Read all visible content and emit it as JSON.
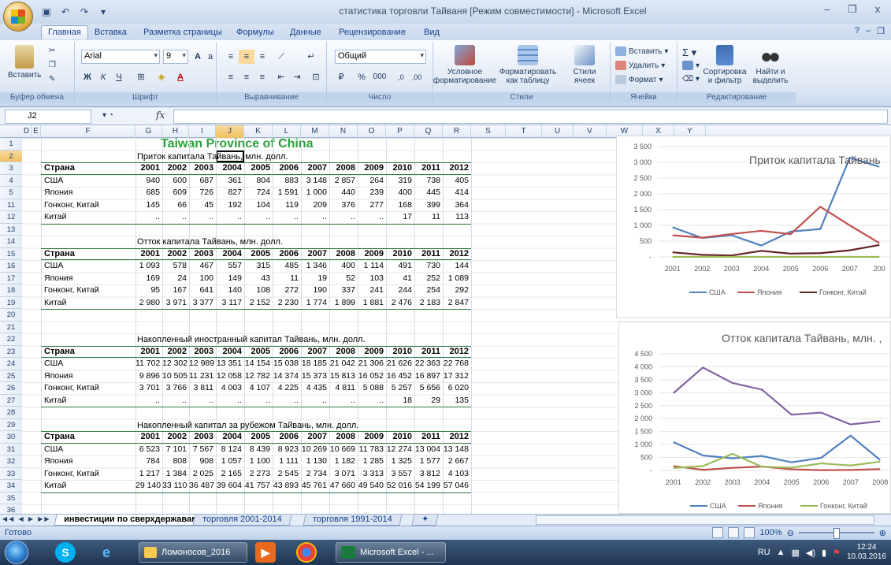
{
  "window": {
    "title": "статистика торговли Тайваня  [Режим совместимости] - Microsoft Excel",
    "minimize": "–",
    "restore": "❐",
    "close": "x"
  },
  "ribbon": {
    "tabs": [
      "Главная",
      "Вставка",
      "Разметка страницы",
      "Формулы",
      "Данные",
      "Рецензирование",
      "Вид"
    ],
    "active_tab": "Главная",
    "paste_label": "Вставить",
    "font_name": "Arial",
    "font_size": "9",
    "number_format": "Общий",
    "conditional_format": "Условное форматирование",
    "format_as_table": "Форматировать как таблицу",
    "cell_styles": "Стили ячеек",
    "insert_cells": "Вставить",
    "delete_cells": "Удалить",
    "format_cells": "Формат",
    "sort_filter": "Сортировка и фильтр",
    "find_select": "Найти и выделить",
    "groups": [
      "Буфер обмена",
      "Шрифт",
      "Выравнивание",
      "Число",
      "Стили",
      "Ячейки",
      "Редактирование"
    ]
  },
  "formula_bar": {
    "name_box": "J2",
    "fx": "fx",
    "formula": ""
  },
  "columns": [
    "D",
    "E",
    "F",
    "G",
    "H",
    "I",
    "J",
    "K",
    "L",
    "M",
    "N",
    "O",
    "P",
    "Q",
    "R",
    "S",
    "T",
    "U",
    "V",
    "W",
    "X",
    "Y"
  ],
  "rows": [
    "1",
    "2",
    "3",
    "4",
    "5",
    "11",
    "12",
    "13",
    "14",
    "15",
    "16",
    "17",
    "18",
    "19",
    "20",
    "21",
    "22",
    "23",
    "24",
    "25",
    "26",
    "27",
    "28",
    "29",
    "30",
    "31",
    "32",
    "33",
    "34",
    "35",
    "36"
  ],
  "sheet": {
    "main_title": "Taiwan Province of China",
    "country_header": "Страна",
    "years": [
      "2001",
      "2002",
      "2003",
      "2004",
      "2005",
      "2006",
      "2007",
      "2008",
      "2009",
      "2010",
      "2011",
      "2012"
    ],
    "tables": [
      {
        "title": "Приток капитала Тайвань, млн. долл.",
        "rows": [
          {
            "country": "США",
            "values": [
              "940",
              "600",
              "687",
              "361",
              "804",
              "883",
              "3 148",
              "2 857",
              "264",
              "319",
              "738",
              "405"
            ]
          },
          {
            "country": "Япония",
            "values": [
              "685",
              "609",
              "726",
              "827",
              "724",
              "1 591",
              "1 000",
              "440",
              "239",
              "400",
              "445",
              "414"
            ]
          },
          {
            "country": "Гонконг, Китай",
            "values": [
              "145",
              "66",
              "45",
              "192",
              "104",
              "119",
              "209",
              "376",
              "277",
              "168",
              "399",
              "364"
            ]
          },
          {
            "country": "Китай",
            "values": [
              "..",
              "..",
              "..",
              "..",
              "..",
              "..",
              "..",
              "..",
              "..",
              "17",
              "11",
              "113"
            ]
          }
        ]
      },
      {
        "title": "Отток капитала Тайвань, млн. долл.",
        "rows": [
          {
            "country": "США",
            "values": [
              "1 093",
              "578",
              "467",
              "557",
              "315",
              "485",
              "1 346",
              "400",
              "1 114",
              "491",
              "730",
              "144"
            ]
          },
          {
            "country": "Япония",
            "values": [
              "169",
              "24",
              "100",
              "149",
              "43",
              "11",
              "19",
              "52",
              "103",
              "41",
              "252",
              "1 089"
            ]
          },
          {
            "country": "Гонконг, Китай",
            "values": [
              "95",
              "167",
              "641",
              "140",
              "108",
              "272",
              "190",
              "337",
              "241",
              "244",
              "254",
              "292"
            ]
          },
          {
            "country": "Китай",
            "values": [
              "2 980",
              "3 971",
              "3 377",
              "3 117",
              "2 152",
              "2 230",
              "1 774",
              "1 899",
              "1 881",
              "2 476",
              "2 183",
              "2 847"
            ]
          }
        ]
      },
      {
        "title": "Накопленный иностранный капитал Тайвань, млн. долл.",
        "rows": [
          {
            "country": "США",
            "values": [
              "11 702",
              "12 302",
              "12 989",
              "13 351",
              "14 154",
              "15 038",
              "18 185",
              "21 042",
              "21 306",
              "21 626",
              "22 363",
              "22 768"
            ]
          },
          {
            "country": "Япония",
            "values": [
              "9 896",
              "10 505",
              "11 231",
              "12 058",
              "12 782",
              "14 374",
              "15 373",
              "15 813",
              "16 052",
              "16 452",
              "16 897",
              "17 312"
            ]
          },
          {
            "country": "Гонконг, Китай",
            "values": [
              "3 701",
              "3 766",
              "3 811",
              "4 003",
              "4 107",
              "4 225",
              "4 435",
              "4 811",
              "5 088",
              "5 257",
              "5 656",
              "6 020"
            ]
          },
          {
            "country": "Китай",
            "values": [
              "..",
              "..",
              "..",
              "..",
              "..",
              "..",
              "..",
              "..",
              "..",
              "18",
              "29",
              "135"
            ]
          }
        ]
      },
      {
        "title": "Накопленный  капитал за рубежом Тайвань, млн. долл.",
        "rows": [
          {
            "country": "США",
            "values": [
              "6 523",
              "7 101",
              "7 567",
              "8 124",
              "8 439",
              "8 923",
              "10 269",
              "10 669",
              "11 783",
              "12 274",
              "13 004",
              "13 148"
            ]
          },
          {
            "country": "Япония",
            "values": [
              "784",
              "808",
              "908",
              "1 057",
              "1 100",
              "1 111",
              "1 130",
              "1 182",
              "1 285",
              "1 325",
              "1 577",
              "2 667"
            ]
          },
          {
            "country": "Гонконг, Китай",
            "values": [
              "1 217",
              "1 384",
              "2 025",
              "2 165",
              "2 273",
              "2 545",
              "2 734",
              "3 071",
              "3 313",
              "3 557",
              "3 812",
              "4 103"
            ]
          },
          {
            "country": "Китай",
            "values": [
              "29 140",
              "33 110",
              "36 487",
              "39 604",
              "41 757",
              "43 893",
              "45 761",
              "47 660",
              "49 540",
              "52 016",
              "54 199",
              "57 046"
            ]
          }
        ]
      }
    ]
  },
  "chart_data": [
    {
      "type": "line",
      "title": "Приток капитала Тайвань",
      "x": [
        "2001",
        "2002",
        "2003",
        "2004",
        "2005",
        "2006",
        "2007",
        "200"
      ],
      "ylim": [
        0,
        3500
      ],
      "yticks": [
        "3 500",
        "3 000",
        "2 500",
        "2 000",
        "1 500",
        "1 000",
        "500",
        "-"
      ],
      "series": [
        {
          "name": "США",
          "color": "#4f81bd",
          "values": [
            940,
            600,
            687,
            361,
            804,
            883,
            3148,
            2857
          ]
        },
        {
          "name": "Япония",
          "color": "#c0504d",
          "values": [
            685,
            609,
            726,
            827,
            724,
            1591,
            1000,
            440
          ]
        },
        {
          "name": "Гонконг, Китай",
          "color": "#632523",
          "values": [
            145,
            66,
            45,
            192,
            104,
            119,
            209,
            376
          ]
        },
        {
          "name": "",
          "color": "#9bbb59",
          "values": [
            0,
            0,
            0,
            0,
            0,
            0,
            0,
            0
          ]
        }
      ],
      "legend": "bottom"
    },
    {
      "type": "line",
      "title": "Отток капитала Тайвань, млн. ,",
      "x": [
        "2001",
        "2002",
        "2003",
        "2004",
        "2005",
        "2006",
        "2007",
        "2008"
      ],
      "ylim": [
        0,
        4500
      ],
      "yticks": [
        "4 500",
        "4 000",
        "3 500",
        "3 000",
        "2 500",
        "2 000",
        "1 500",
        "1 000",
        "500",
        "-"
      ],
      "series": [
        {
          "name": "США",
          "color": "#4f81bd",
          "values": [
            1093,
            578,
            467,
            557,
            315,
            485,
            1346,
            400
          ]
        },
        {
          "name": "Япония",
          "color": "#c0504d",
          "values": [
            169,
            24,
            100,
            149,
            43,
            11,
            19,
            52
          ]
        },
        {
          "name": "Гонконг, Китай",
          "color": "#9bbb59",
          "values": [
            95,
            167,
            641,
            140,
            108,
            272,
            190,
            337
          ]
        },
        {
          "name": "",
          "color": "#8064a2",
          "values": [
            2980,
            3971,
            3377,
            3117,
            2152,
            2230,
            1774,
            1899
          ]
        }
      ],
      "legend": "bottom"
    }
  ],
  "sheet_tabs": [
    "инвестиции по сверхдержавам",
    "торговля 2001-2014",
    "торговля 1991-2014"
  ],
  "active_sheet": "инвестиции по сверхдержавам",
  "status": {
    "ready": "Готово",
    "zoom": "100%"
  },
  "taskbar": {
    "items": [
      "Ломоносов_2016",
      "Microsoft Excel - ..."
    ],
    "lang": "RU",
    "time": "12:24",
    "date": "10.03.2016"
  }
}
